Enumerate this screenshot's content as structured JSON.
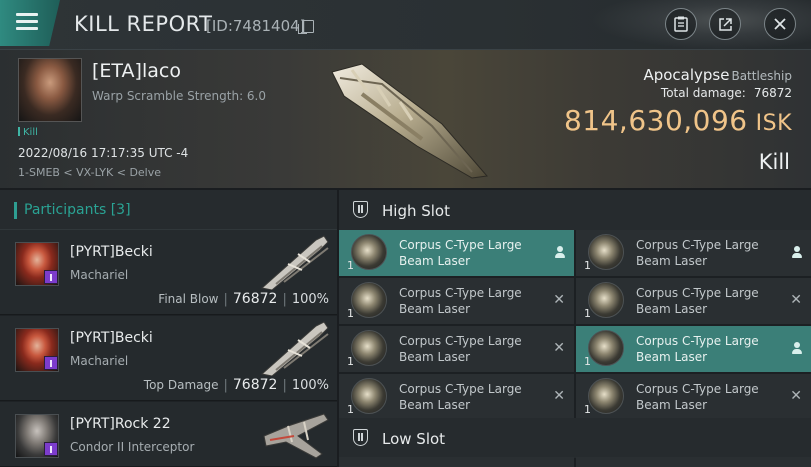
{
  "header": {
    "title": "KILL REPORT",
    "report_id": "[ID:7481404]"
  },
  "victim": {
    "name": "[ETA]laco",
    "warp_scramble": "Warp Scramble Strength: 6.0",
    "kill_tag": "Kill",
    "datetime": "2022/08/16 17:17:35 UTC -4",
    "location": "1-SMEB < VX-LYK < Delve",
    "ship_name": "Apocalypse",
    "ship_class": "Battleship",
    "total_damage_label": "Total damage:",
    "total_damage": "76872",
    "isk_value": "814,630,096",
    "isk_unit": "ISK",
    "result": "Kill"
  },
  "participants": {
    "label": "Participants",
    "count": "[3]",
    "rows": [
      {
        "name": "[PYRT]Becki",
        "ship": "Machariel",
        "role": "Final Blow",
        "damage": "76872",
        "percent": "100%"
      },
      {
        "name": "[PYRT]Becki",
        "ship": "Machariel",
        "role": "Top Damage",
        "damage": "76872",
        "percent": "100%"
      },
      {
        "name": "[PYRT]Rock 22",
        "ship": "Condor II Interceptor",
        "role": "",
        "damage": "",
        "percent": ""
      }
    ]
  },
  "slots": {
    "high_label": "High Slot",
    "low_label": "Low Slot",
    "high_items": [
      {
        "name": "Corpus C-Type Large Beam Laser",
        "qty": "1",
        "status": "destroyed-by-pilot"
      },
      {
        "name": "Corpus C-Type Large Beam Laser",
        "qty": "1",
        "status": "destroyed-by-pilot"
      },
      {
        "name": "Corpus C-Type Large Beam Laser",
        "qty": "1",
        "status": "dropped"
      },
      {
        "name": "Corpus C-Type Large Beam Laser",
        "qty": "1",
        "status": "dropped"
      },
      {
        "name": "Corpus C-Type Large Beam Laser",
        "qty": "1",
        "status": "dropped"
      },
      {
        "name": "Corpus C-Type Large Beam Laser",
        "qty": "1",
        "status": "destroyed-by-pilot"
      },
      {
        "name": "Corpus C-Type Large Beam Laser",
        "qty": "1",
        "status": "dropped"
      },
      {
        "name": "Corpus C-Type Large Beam Laser",
        "qty": "1",
        "status": "dropped"
      }
    ]
  },
  "colors": {
    "accent_teal": "#2aa394",
    "isk_gold": "#f0c489",
    "highlight_row": "#3b7f78"
  }
}
